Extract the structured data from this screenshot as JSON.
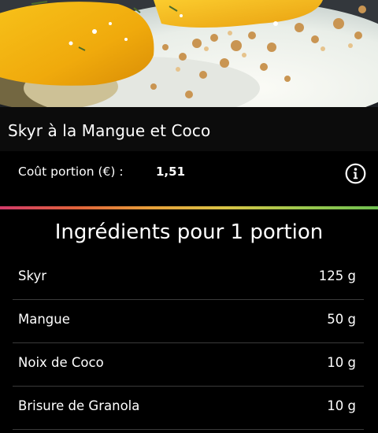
{
  "recipe": {
    "title": "Skyr à la Mangue et Coco",
    "photo_icon": "recipe-photo"
  },
  "cost": {
    "label": "Coût portion (€) :",
    "value": "1,51",
    "info_icon": "info-icon"
  },
  "ingredients": {
    "heading": "Ingrédients pour 1 portion",
    "items": [
      {
        "name": "Skyr",
        "quantity": "125 g"
      },
      {
        "name": "Mangue",
        "quantity": "50 g"
      },
      {
        "name": "Noix de Coco",
        "quantity": "10 g"
      },
      {
        "name": "Brisure de Granola",
        "quantity": "10 g"
      }
    ]
  },
  "colors": {
    "background": "#000000",
    "text": "#ffffff",
    "divider_gradient": [
      "#d23b6a",
      "#e0623b",
      "#e7a03a",
      "#d8c446",
      "#9cc84e",
      "#6fbf50"
    ]
  }
}
